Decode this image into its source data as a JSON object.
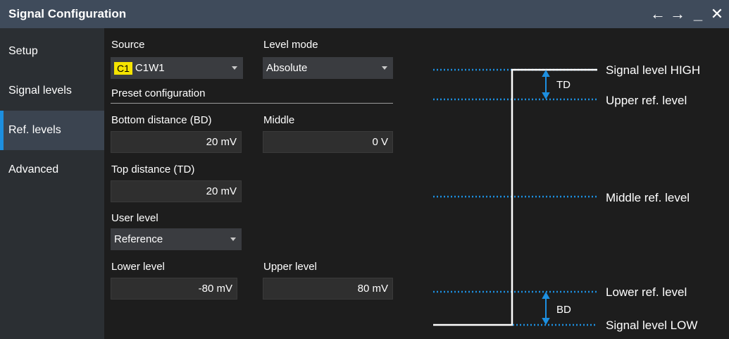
{
  "window": {
    "title": "Signal Configuration"
  },
  "sidebar": {
    "items": [
      {
        "label": "Setup"
      },
      {
        "label": "Signal levels"
      },
      {
        "label": "Ref. levels"
      },
      {
        "label": "Advanced"
      }
    ],
    "active_index": 2
  },
  "form": {
    "source": {
      "label": "Source",
      "badge": "C1",
      "value": "C1W1"
    },
    "level_mode": {
      "label": "Level mode",
      "value": "Absolute"
    },
    "preset_configuration": {
      "label": "Preset configuration"
    },
    "bottom_distance": {
      "label": "Bottom distance (BD)",
      "value": "20 mV"
    },
    "middle": {
      "label": "Middle",
      "value": "0 V"
    },
    "top_distance": {
      "label": "Top distance (TD)",
      "value": "20 mV"
    },
    "user_level": {
      "label": "User level",
      "value": "Reference"
    },
    "lower_level": {
      "label": "Lower level",
      "value": "-80 mV"
    },
    "upper_level": {
      "label": "Upper level",
      "value": "80 mV"
    }
  },
  "diagram": {
    "labels": {
      "signal_high": "Signal level HIGH",
      "upper_ref": "Upper ref. level",
      "middle_ref": "Middle ref. level",
      "lower_ref": "Lower ref. level",
      "signal_low": "Signal level LOW",
      "td": "TD",
      "bd": "BD"
    }
  },
  "colors": {
    "accent": "#1d8fe0",
    "badge": "#f5e400",
    "titlebar": "#3f4b5b",
    "sidebar": "#2b2f33"
  },
  "icons": [
    "arrow-left-icon",
    "arrow-right-icon",
    "minimize-icon",
    "close-icon"
  ]
}
